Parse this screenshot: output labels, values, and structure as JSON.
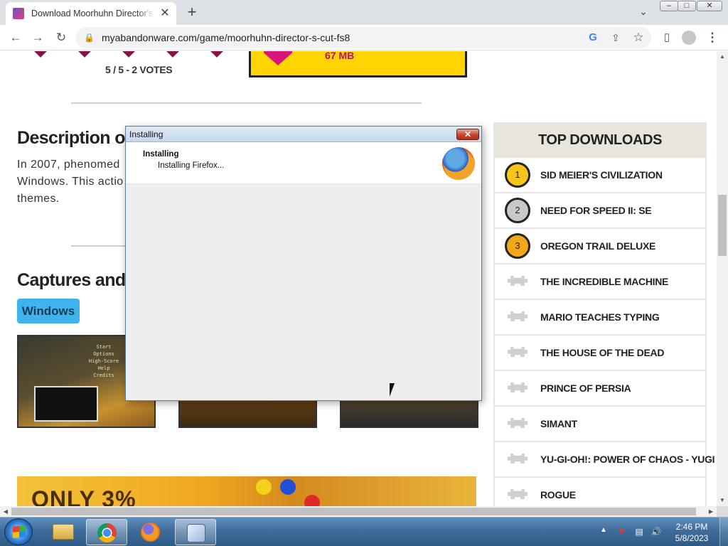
{
  "browser": {
    "tab_title": "Download Moorhuhn Director's Cut",
    "tab_close": "✕",
    "new_tab": "+",
    "url": "myabandonware.com/game/moorhuhn-director-s-cut-fs8",
    "window_buttons": {
      "minimize": "–",
      "maximize": "□",
      "close": "✕"
    }
  },
  "game": {
    "votes": "5 / 5 - 2 VOTES",
    "download_size": "67 MB"
  },
  "description": {
    "title": "Description of",
    "text_line1": "In 2007, phenomed",
    "text_line2": "Windows. This actio",
    "text_line3": "themes."
  },
  "captures": {
    "title": "Captures and S",
    "platform_button": "Windows",
    "thumb1_menu": "Start\nOptions\nHigh-Score\nHelp\nCredits"
  },
  "ad": {
    "text": "ONLY 3%"
  },
  "top_downloads": {
    "title": "TOP DOWNLOADS",
    "items": [
      {
        "rank": "1",
        "name": "SID MEIER'S CIVILIZATION",
        "color": "#f5c518"
      },
      {
        "rank": "2",
        "name": "NEED FOR SPEED II: SE",
        "color": "#c8c8c8"
      },
      {
        "rank": "3",
        "name": "OREGON TRAIL DELUXE",
        "color": "#f0a818"
      },
      {
        "rank": "",
        "name": "THE INCREDIBLE MACHINE"
      },
      {
        "rank": "",
        "name": "MARIO TEACHES TYPING"
      },
      {
        "rank": "",
        "name": "THE HOUSE OF THE DEAD"
      },
      {
        "rank": "",
        "name": "PRINCE OF PERSIA"
      },
      {
        "rank": "",
        "name": "SIMANT"
      },
      {
        "rank": "",
        "name": "YU-GI-OH!: POWER OF CHAOS - YUGI"
      },
      {
        "rank": "",
        "name": "ROGUE"
      }
    ]
  },
  "dialog": {
    "title": "Installing",
    "heading": "Installing",
    "status": "Installing Firefox...",
    "close": "✕"
  },
  "taskbar": {
    "time": "2:46 PM",
    "date": "5/8/2023",
    "apps": [
      "explorer-icon",
      "chrome-icon",
      "firefox-icon",
      "installer-icon"
    ]
  },
  "colors": {
    "accent_pink": "#b51660",
    "download_yellow": "#ffd400",
    "windows_chip": "#3fb4ec"
  }
}
